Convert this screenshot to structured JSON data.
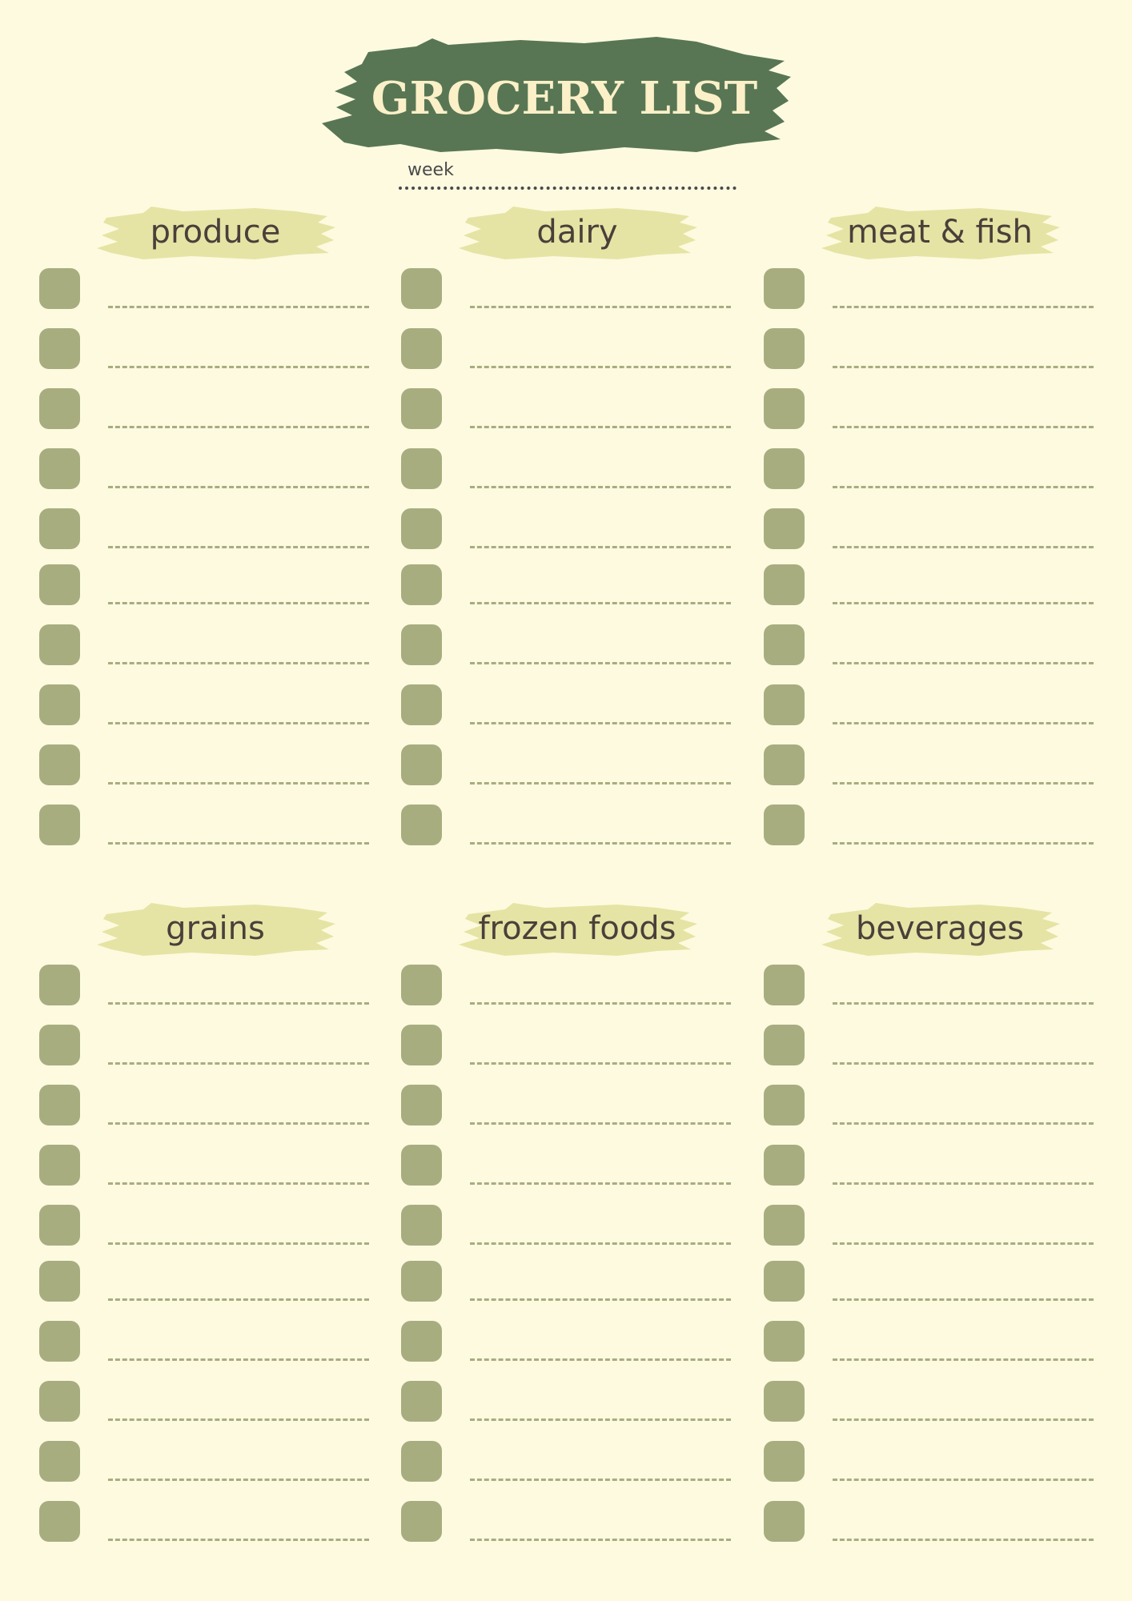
{
  "header": {
    "title": "GROCERY LIST",
    "week_label": "week"
  },
  "colors": {
    "background": "#fdfae0",
    "title_brush": "#587654",
    "title_text": "#fbf0c8",
    "section_brush": "#e5e4a4",
    "checkbox": "#a8ad80",
    "text_dark": "#4b3f3a"
  },
  "sections": [
    {
      "title": "produce"
    },
    {
      "title": "dairy"
    },
    {
      "title": "meat & fish"
    },
    {
      "title": "grains"
    },
    {
      "title": "frozen foods"
    },
    {
      "title": "beverages"
    }
  ],
  "rows_per_section": 10
}
